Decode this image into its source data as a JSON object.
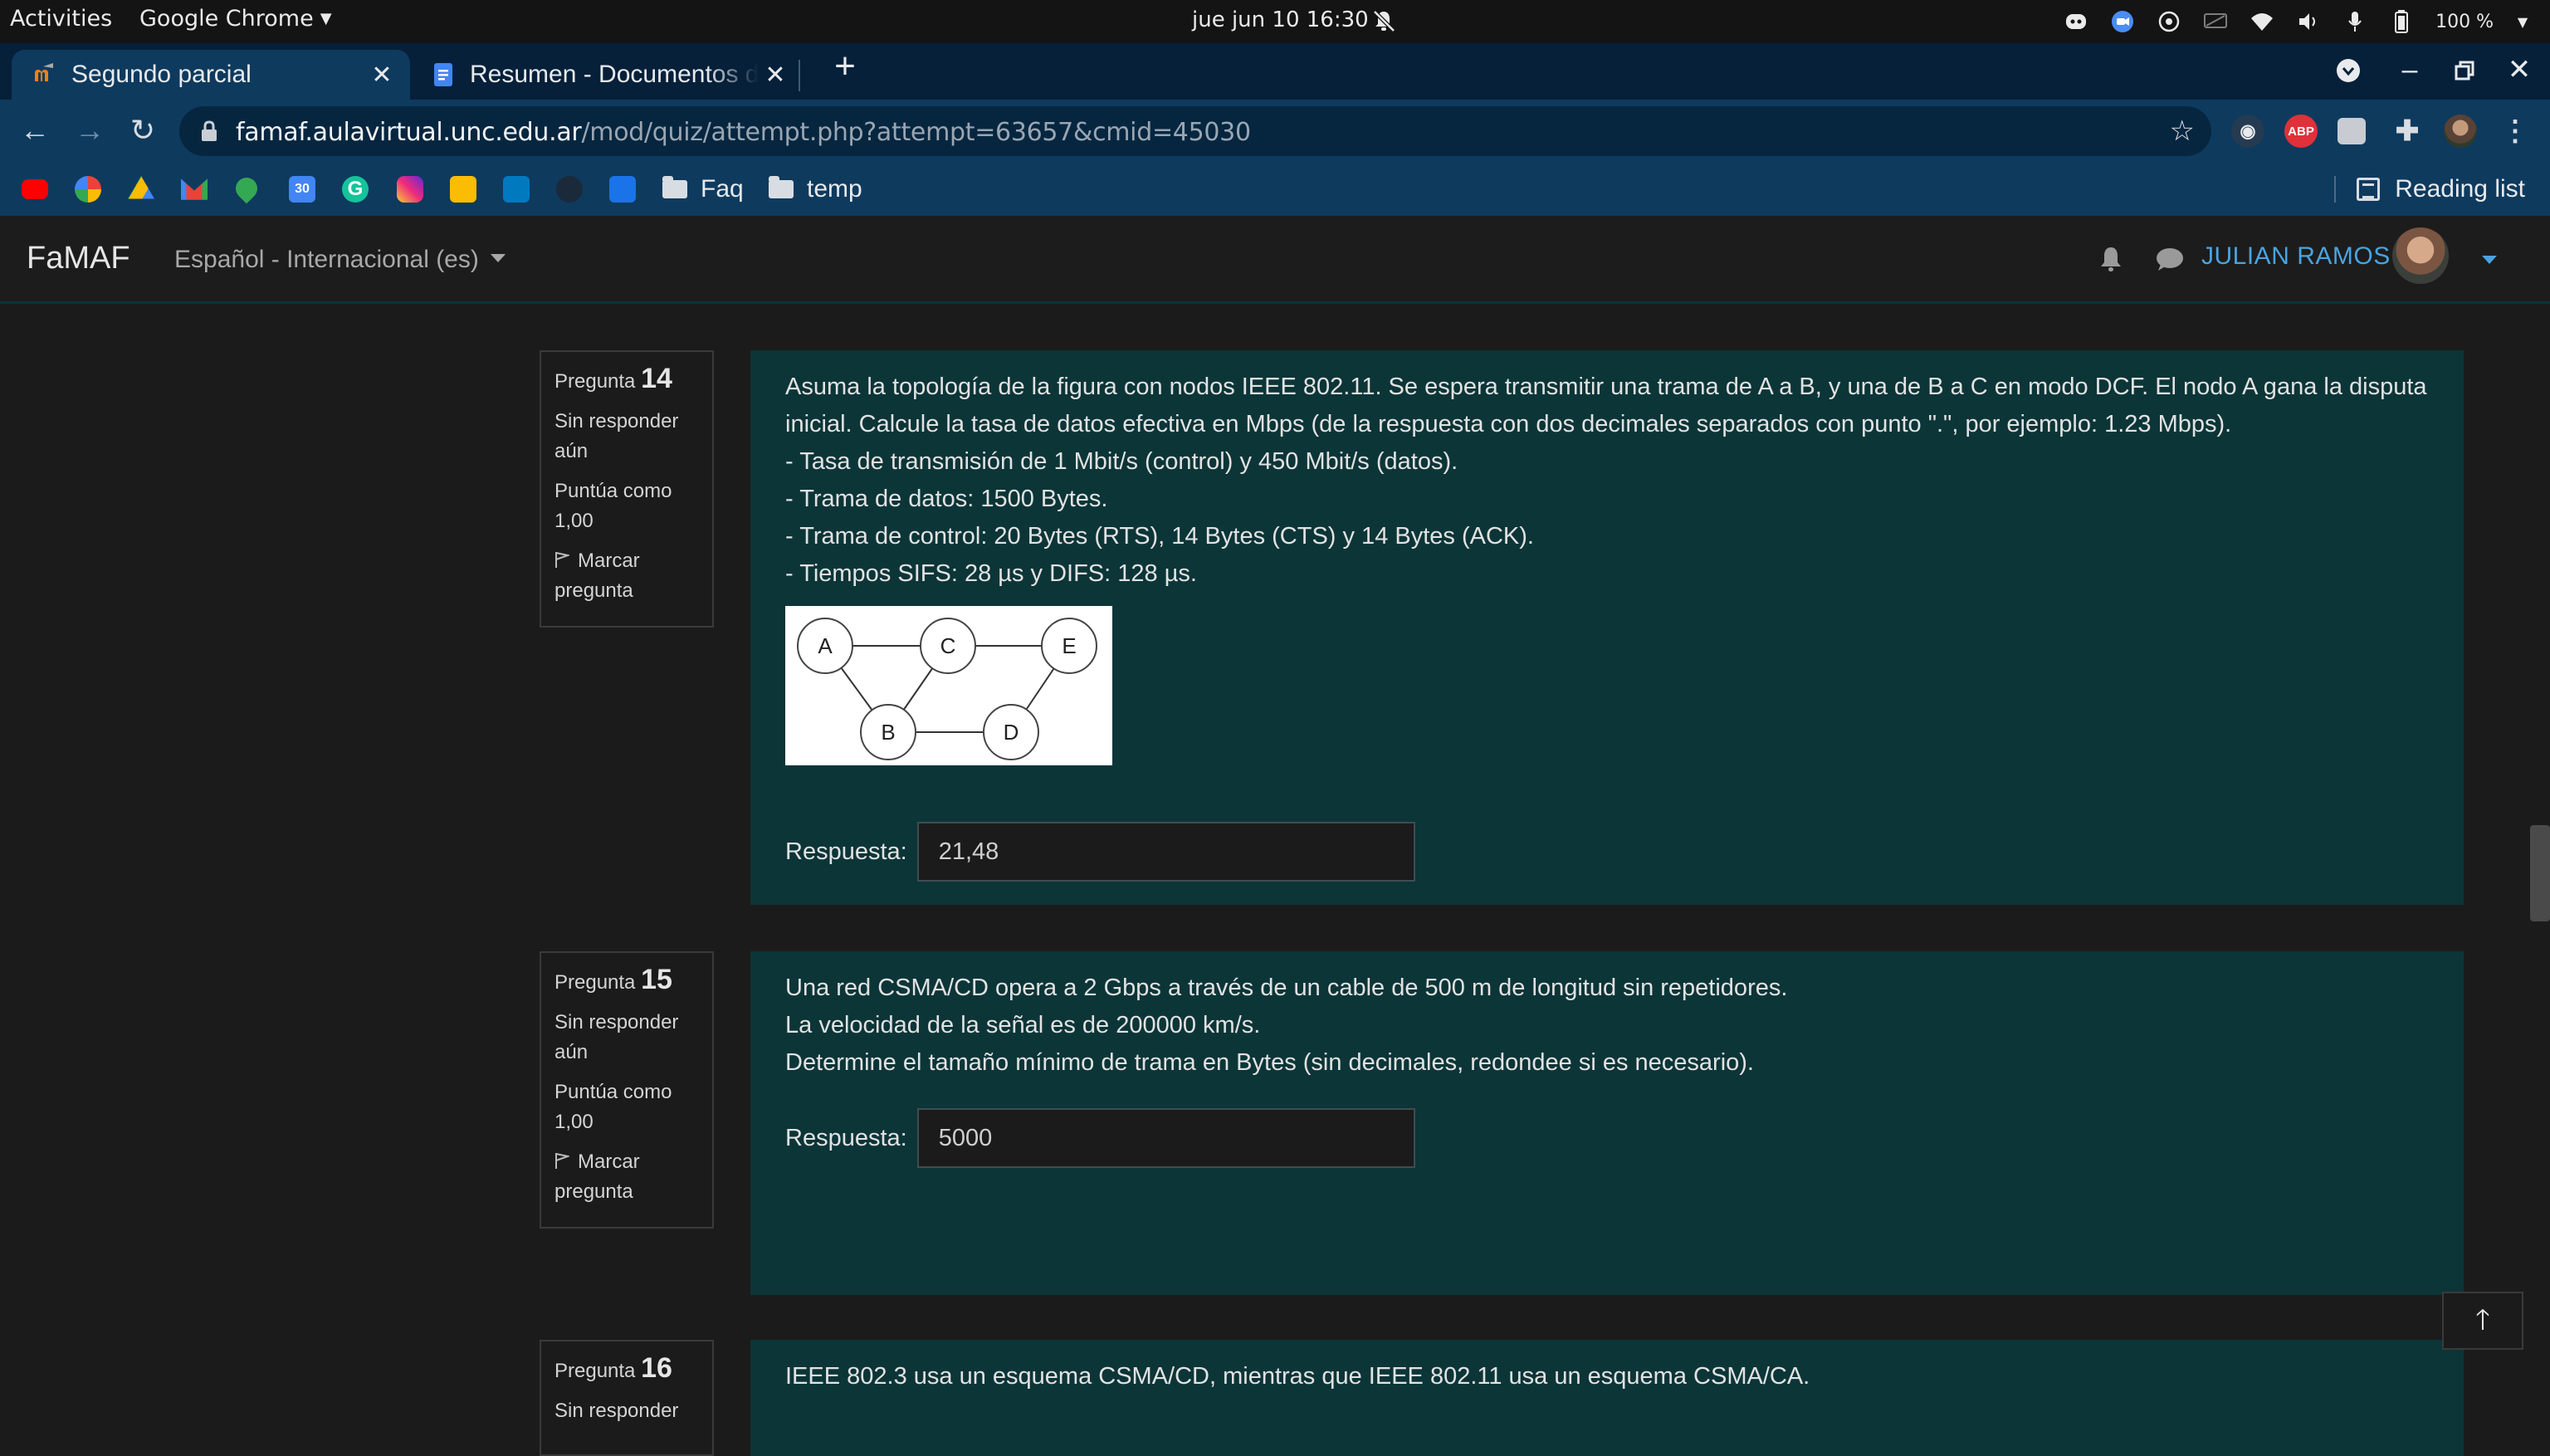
{
  "gnome": {
    "activities": "Activities",
    "app_menu": "Google Chrome",
    "clock": "jue jun 10  16:30",
    "battery": "100 %"
  },
  "browser": {
    "tabs": [
      {
        "title": "Segundo parcial",
        "active": true
      },
      {
        "title": "Resumen - Documentos de Google",
        "active": false
      }
    ],
    "url_host": "famaf.aulavirtual.unc.edu.ar",
    "url_path": "/mod/quiz/attempt.php?attempt=63657&cmid=45030",
    "bookmark_folders": [
      "Faq",
      "temp"
    ],
    "reading_list": "Reading list",
    "extension_abp": "ABP"
  },
  "site": {
    "brand": "FaMAF",
    "language": "Español - Internacional (es)",
    "user_name": "JULIAN RAMOS"
  },
  "questions": [
    {
      "label": "Pregunta",
      "number": "14",
      "status": "Sin responder aún",
      "score": "Puntúa como 1,00",
      "flag": "Marcar pregunta",
      "text": [
        "Asuma la topología de la figura con nodos IEEE 802.11. Se espera transmitir una trama de A a B, y una de B a C en modo DCF. El nodo A gana la disputa inicial. Calcule la tasa de datos efectiva en Mbps (de la respuesta con dos decimales separados con punto \".\", por ejemplo: 1.23 Mbps).",
        "- Tasa de transmisión de 1 Mbit/s (control) y 450 Mbit/s (datos).",
        "- Trama de datos: 1500 Bytes.",
        "- Trama de control: 20 Bytes (RTS), 14 Bytes (CTS) y 14 Bytes (ACK).",
        "- Tiempos SIFS: 28 µs y DIFS: 128 µs."
      ],
      "figure_nodes": [
        "A",
        "C",
        "E",
        "B",
        "D"
      ],
      "answer_label": "Respuesta:",
      "answer_value": "21,48"
    },
    {
      "label": "Pregunta",
      "number": "15",
      "status": "Sin responder aún",
      "score": "Puntúa como 1,00",
      "flag": "Marcar pregunta",
      "text": [
        "Una red CSMA/CD opera a 2 Gbps a través de un cable de 500 m de longitud sin repetidores.",
        "La velocidad de la señal es de 200000 km/s.",
        "Determine el tamaño mínimo de trama en Bytes (sin decimales, redondee si es necesario)."
      ],
      "answer_label": "Respuesta:",
      "answer_value": "5000"
    },
    {
      "label": "Pregunta",
      "number": "16",
      "status": "Sin responder",
      "text": [
        "IEEE 802.3 usa un esquema CSMA/CD, mientras que IEEE 802.11 usa un esquema CSMA/CA."
      ]
    }
  ],
  "colors": {
    "content_bg": "#0c3538",
    "page_bg": "#1b1b1b",
    "link_blue": "#4aa3df",
    "chrome_frame": "#0e3a5e"
  }
}
